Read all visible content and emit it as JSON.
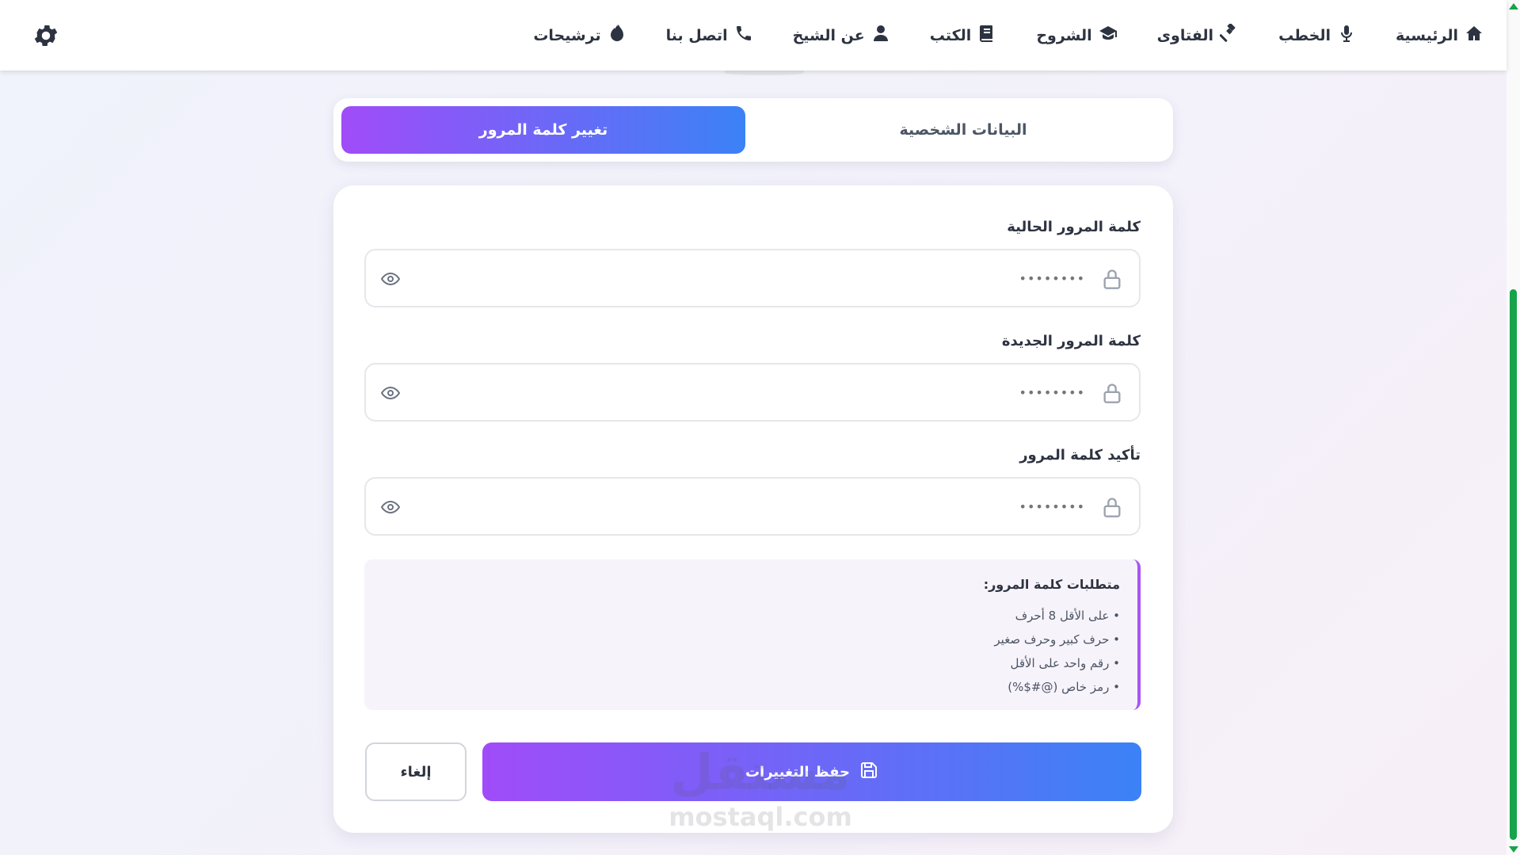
{
  "nav": {
    "items": [
      {
        "label": "الرئيسية",
        "icon": "home-icon"
      },
      {
        "label": "الخطب",
        "icon": "microphone-icon"
      },
      {
        "label": "الفتاوى",
        "icon": "gavel-icon"
      },
      {
        "label": "الشروح",
        "icon": "graduation-cap-icon"
      },
      {
        "label": "الكتب",
        "icon": "book-icon"
      },
      {
        "label": "عن الشيخ",
        "icon": "user-icon"
      },
      {
        "label": "اتصل بنا",
        "icon": "phone-icon"
      },
      {
        "label": "ترشيحات",
        "icon": "fire-icon"
      }
    ],
    "settings_icon": "gear-icon"
  },
  "tabs": {
    "personal": "البيانات الشخصية",
    "password": "تغيير كلمة المرور",
    "active": "password"
  },
  "form": {
    "current": {
      "label": "كلمة المرور الحالية",
      "placeholder": "••••••••"
    },
    "new": {
      "label": "كلمة المرور الجديدة",
      "placeholder": "••••••••"
    },
    "confirm": {
      "label": "تأكيد كلمة المرور",
      "placeholder": "••••••••"
    }
  },
  "requirements": {
    "title": "متطلبات كلمة المرور:",
    "items": [
      "• على الأقل 8 أحرف",
      "• حرف كبير وحرف صغير",
      "• رقم واحد على الأقل",
      "• رمز خاص (@#$%)"
    ]
  },
  "actions": {
    "save": "حفظ التغييرات",
    "cancel": "إلغاء"
  },
  "watermark": {
    "arabic": "مستقل",
    "latin": "mostaql.com"
  },
  "colors": {
    "gradient_start": "#a04cf8",
    "gradient_end": "#3b82f6",
    "accent_border": "#a855f7",
    "scrollbar": "#16a34a"
  }
}
